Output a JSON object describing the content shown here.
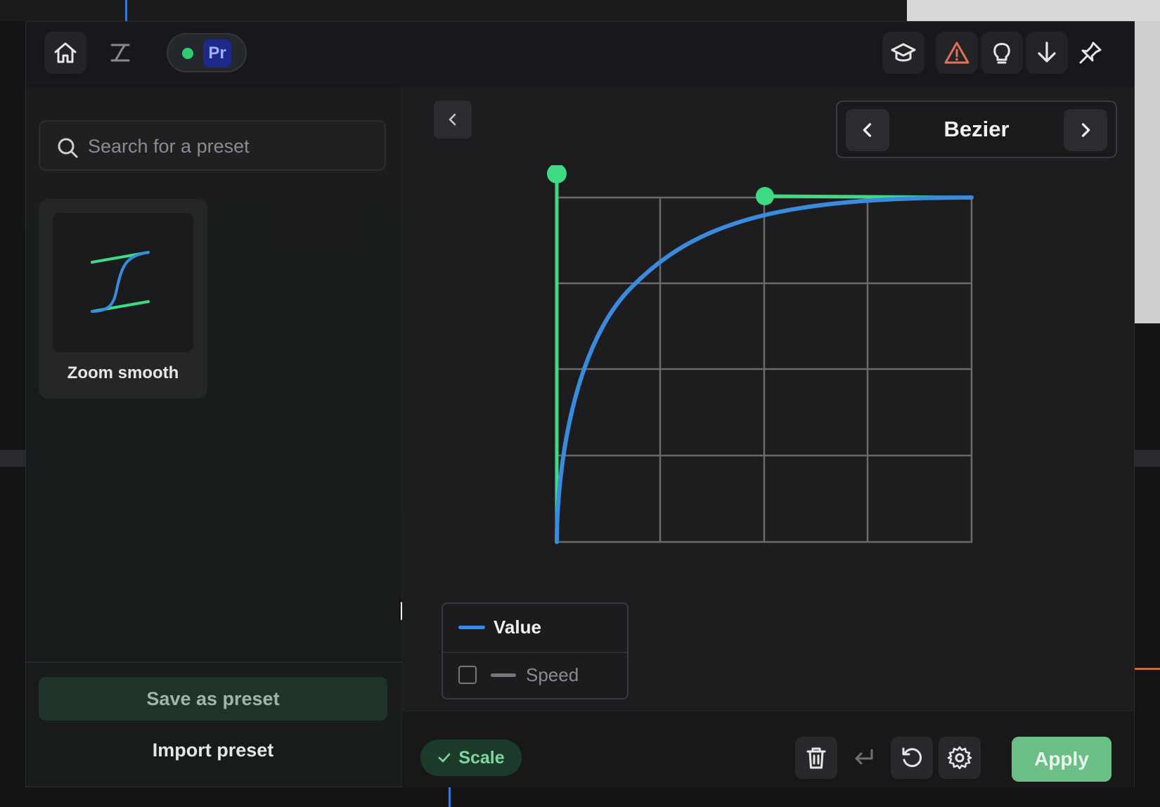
{
  "header": {
    "app_badge": "Pr"
  },
  "left_panel": {
    "search_placeholder": "Search for a preset",
    "presets": [
      {
        "name": "Zoom smooth"
      }
    ],
    "save_label": "Save as preset",
    "import_label": "Import preset"
  },
  "editor": {
    "curve_type": "Bezier",
    "legend": {
      "value_label": "Value",
      "speed_label": "Speed",
      "speed_checked": false
    },
    "scale_label": "Scale",
    "apply_label": "Apply"
  },
  "colors": {
    "accent_green": "#3ddc84",
    "curve_blue": "#3a8be0",
    "apply_green": "#6bbf86",
    "app_status_green": "#2ecc71"
  },
  "icons": {
    "topbar_left": [
      "home-icon",
      "curve-tool-icon"
    ],
    "topbar_right": [
      "graduation-cap-icon",
      "warning-icon",
      "lightbulb-icon",
      "download-arrow-icon",
      "pin-icon"
    ],
    "toolbar": [
      "trash-icon",
      "return-icon",
      "reset-icon",
      "gear-icon"
    ]
  }
}
